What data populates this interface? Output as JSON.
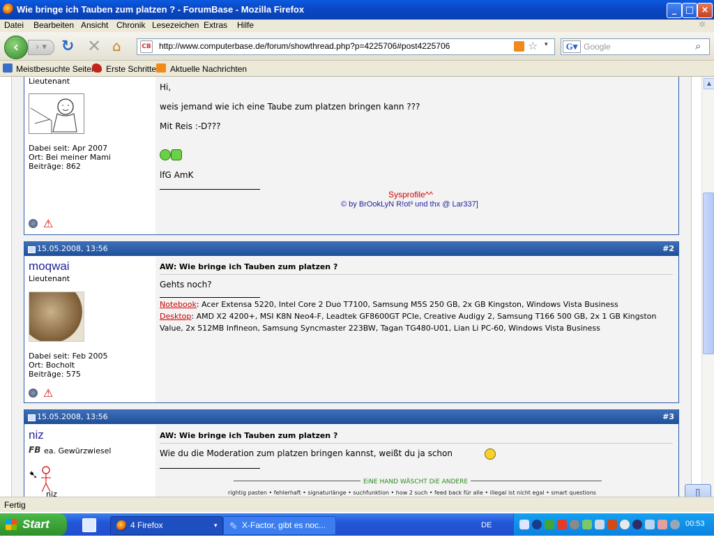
{
  "window": {
    "title": "Wie bringe ich Tauben zum platzen ? - ForumBase - Mozilla Firefox"
  },
  "menu": [
    "Datei",
    "Bearbeiten",
    "Ansicht",
    "Chronik",
    "Lesezeichen",
    "Extras",
    "Hilfe"
  ],
  "navigation": {
    "url": "http://www.computerbase.de/forum/showthread.php?p=4225706#post4225706",
    "search_placeholder": "Google"
  },
  "bookmarks": [
    "Meistbesuchte Seiten",
    "Erste Schritte",
    "Aktuelle Nachrichten"
  ],
  "posts": [
    {
      "user_rank": "Lieutenant",
      "joined": "Dabei seit: Apr 2007",
      "location": "Ort: Bei meiner Mami",
      "count": "Beiträge: 862",
      "lines": [
        "Hi,",
        "weis jemand wie ich eine Taube zum platzen bringen kann ???",
        "Mit Reis :-D???"
      ],
      "closing": "lfG AmK",
      "sig_red": "Sysprofile^^",
      "sig_blue": "© by BrOokLyN R!ot³ und thx @ Lar337]"
    },
    {
      "date": "15.05.2008, 13:56",
      "number": "#2",
      "username": "moqwai",
      "user_rank": "Lieutenant",
      "joined": "Dabei seit: Feb 2005",
      "location": "Ort: Bocholt",
      "count": "Beiträge: 575",
      "title": "AW: Wie bringe ich Tauben zum platzen ?",
      "text": "Gehts noch?",
      "sig_nb_label": "Notebook",
      "sig_nb_text": ": Acer Extensa 5220, Intel Core 2 Duo T7100, Samsung M5S 250 GB, 2x GB Kingston, Windows Vista Business",
      "sig_dt_label": "Desktop",
      "sig_dt_text": ": AMD X2 4200+, MSI K8N Neo4-F, Leadtek GF8600GT PCIe, Creative Audigy 2, Samsung T166 500 GB, 2x 1 GB Kingston Value, 2x 512MB Infineon, Samsung Syncmaster 223BW, Tagan TG480-U01, Lian Li PC-60, Windows Vista Business"
    },
    {
      "date": "15.05.2008, 13:56",
      "number": "#3",
      "username": "niz",
      "user_rank": "ea. Gewürzwiesel",
      "avatar_label": "niz",
      "title": "AW: Wie bringe ich Tauben zum platzen ?",
      "text": "Wie du die Moderation zum platzen bringen kannst, weißt du ja schon",
      "sig_banner": "EiNE HAND WÄSCHT DiE ANDERE",
      "sig_links": "rightig pasten • fehlerhaft • signaturlänge • suchfunktion • how 2 such • feed back für alle • illegal ist nicht egal • smart questions"
    }
  ],
  "status": {
    "text": "Fertig"
  },
  "taskbar": {
    "start_label": "Start",
    "task1": "4 Firefox",
    "task2": "X-Factor, gibt es noc...",
    "lang": "DE",
    "clock": "00:53"
  }
}
